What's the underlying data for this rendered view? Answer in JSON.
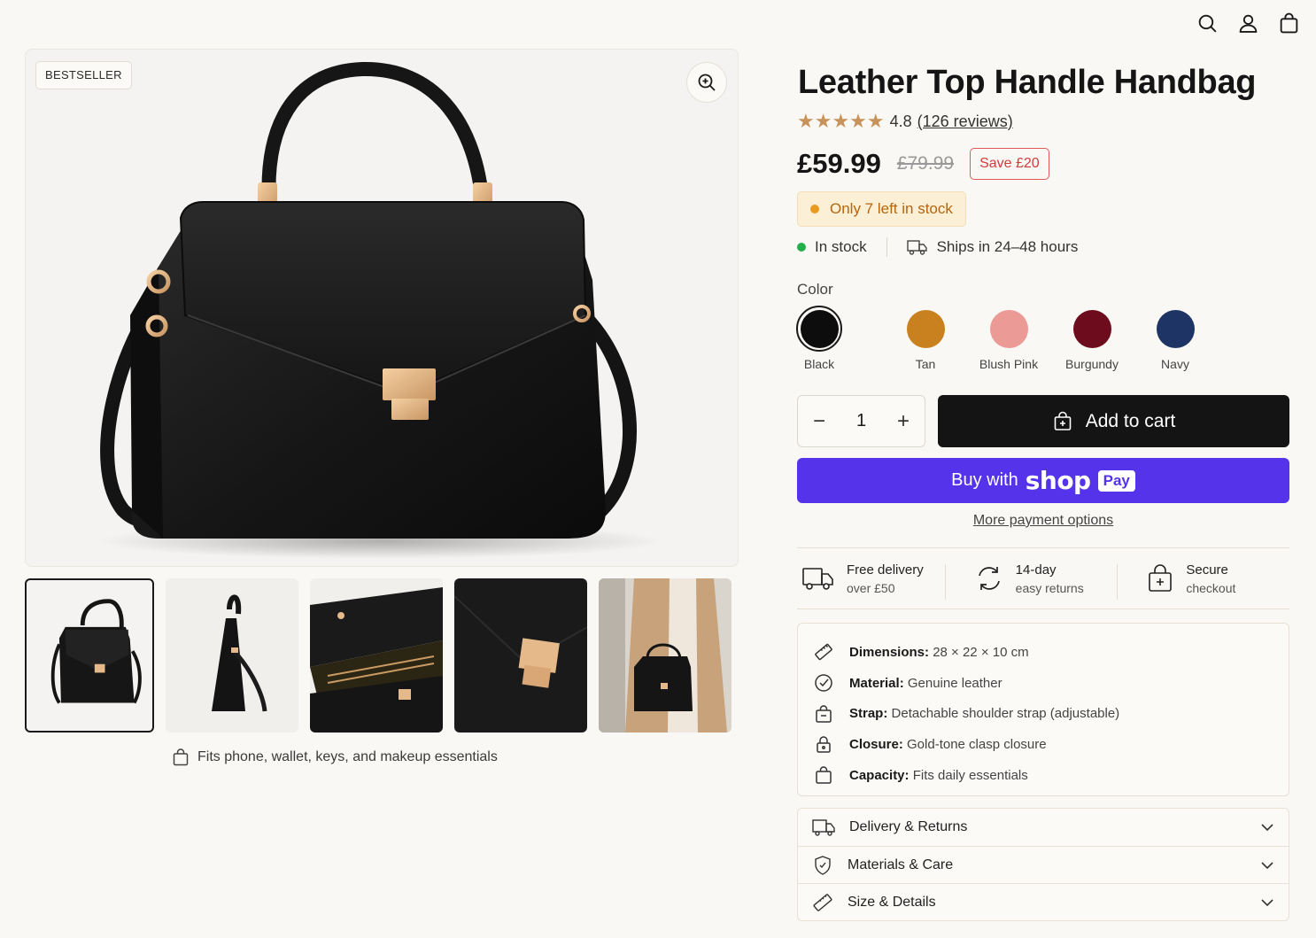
{
  "header": {
    "icons": [
      "search-icon",
      "account-icon",
      "cart-icon"
    ]
  },
  "gallery": {
    "badge": "BESTSELLER",
    "thumbnails": [
      "front",
      "side",
      "interior",
      "clasp-detail",
      "worn-on-arm"
    ],
    "selected_thumbnail": 0,
    "note": "Fits phone, wallet, keys, and makeup essentials"
  },
  "product": {
    "title": "Leather Top Handle Handbag",
    "rating": "4.8",
    "reviews": "(126 reviews)",
    "price": "£59.99",
    "old_price": "£79.99",
    "save": "Save £20",
    "stock_alert": "Only 7 left in stock",
    "stock_status": "In stock",
    "shipping": "Ships in 24–48 hours",
    "color_label": "Color",
    "colors": [
      {
        "name": "Black",
        "hex": "#0d0d0d"
      },
      {
        "name": "Tan",
        "hex": "#c9811f"
      },
      {
        "name": "Blush Pink",
        "hex": "#ec9a95"
      },
      {
        "name": "Burgundy",
        "hex": "#6d0c1d"
      },
      {
        "name": "Navy",
        "hex": "#1e3464"
      }
    ],
    "selected_color": "Black",
    "quantity": "1",
    "add_to_cart": "Add to cart",
    "shop_pay": {
      "buy": "Buy with",
      "shop": "shop",
      "pay": "Pay"
    },
    "more_payment": "More payment options"
  },
  "perks": [
    {
      "line1": "Free delivery",
      "line2": "over £50",
      "icon": "truck-icon"
    },
    {
      "line1": "14-day",
      "line2": "easy returns",
      "icon": "returns-icon"
    },
    {
      "line1": "Secure",
      "line2": "checkout",
      "icon": "secure-bag-icon"
    }
  ],
  "specs": [
    {
      "label": "Dimensions:",
      "value": "28 × 22 × 10 cm",
      "icon": "ruler-icon"
    },
    {
      "label": "Material:",
      "value": "Genuine leather",
      "icon": "badge-check-icon"
    },
    {
      "label": "Strap:",
      "value": "Detachable shoulder strap (adjustable)",
      "icon": "bag-icon"
    },
    {
      "label": "Closure:",
      "value": "Gold-tone clasp closure",
      "icon": "lock-icon"
    },
    {
      "label": "Capacity:",
      "value": "Fits daily essentials",
      "icon": "bag-icon"
    }
  ],
  "accordion": [
    {
      "label": "Delivery & Returns",
      "icon": "truck-icon"
    },
    {
      "label": "Materials & Care",
      "icon": "shield-icon"
    },
    {
      "label": "Size & Details",
      "icon": "ruler-icon"
    }
  ],
  "colors": {
    "accent": "#141414",
    "shop_pay": "#5433eb",
    "stars": "#c8935a",
    "sale": "#d33a3a",
    "stock_alert_bg": "#fbefd5",
    "in_stock": "#22b04b"
  }
}
